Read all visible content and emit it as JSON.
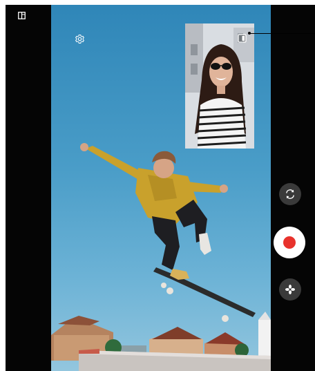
{
  "screen": {
    "mode": "dual-recording",
    "controls": {
      "layout_icon": "split-view-icon",
      "settings_icon": "gear-icon",
      "pip_switch_icon": "pip-switch-icon",
      "flip_camera_icon": "flip-camera-icon",
      "record_icon": "record-icon",
      "effects_icon": "flower-effects-icon"
    },
    "colors": {
      "record_red": "#e8322c",
      "button_gray": "#3a3a3a",
      "record_ring": "#ffffff"
    }
  }
}
